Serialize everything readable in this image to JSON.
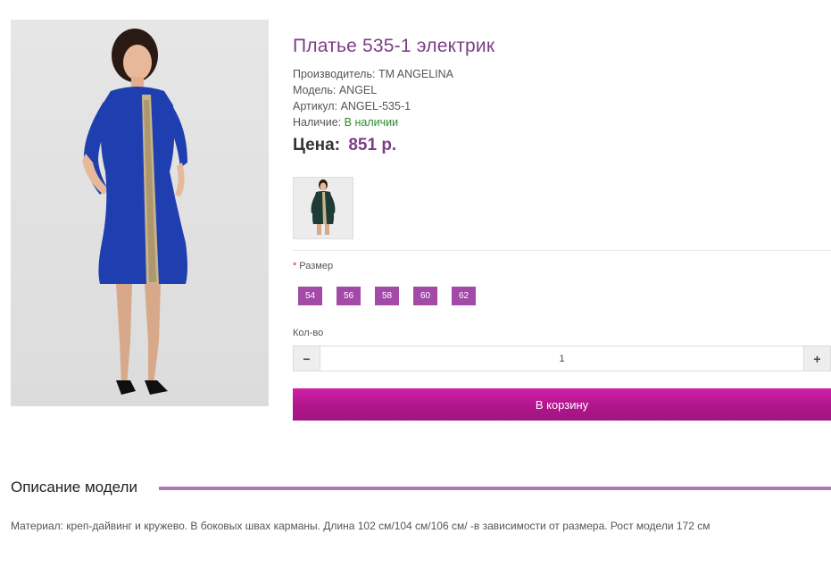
{
  "product": {
    "title": "Платье 535-1 электрик",
    "manufacturer_label": "Производитель:",
    "manufacturer_value": "TM ANGELINA",
    "model_label": "Модель:",
    "model_value": "ANGEL",
    "sku_label": "Артикул:",
    "sku_value": "ANGEL-535-1",
    "stock_label": "Наличие:",
    "stock_value": "В наличии",
    "price_label": "Цена:",
    "price_value": "851 р."
  },
  "options": {
    "size_label": "Размер",
    "required_mark": "*",
    "sizes": [
      "54",
      "56",
      "58",
      "60",
      "62"
    ]
  },
  "quantity": {
    "label": "Кол-во",
    "value": "1",
    "minus": "−",
    "plus": "+"
  },
  "cart": {
    "button_label": "В корзину"
  },
  "description": {
    "heading": "Описание модели",
    "text": "Материал: креп-дайвинг и кружево. В боковых швах карманы. Длина 102 см/104 см/106 см/ -в зависимости от размера. Рост модели 172 см"
  },
  "colors": {
    "accent": "#7b3f86",
    "size_button": "#a34aa8",
    "cart_button": "#b3168d",
    "in_stock": "#2d8a2d",
    "dress_main": "#1f3fb0",
    "dress_thumb": "#1e3b35"
  }
}
